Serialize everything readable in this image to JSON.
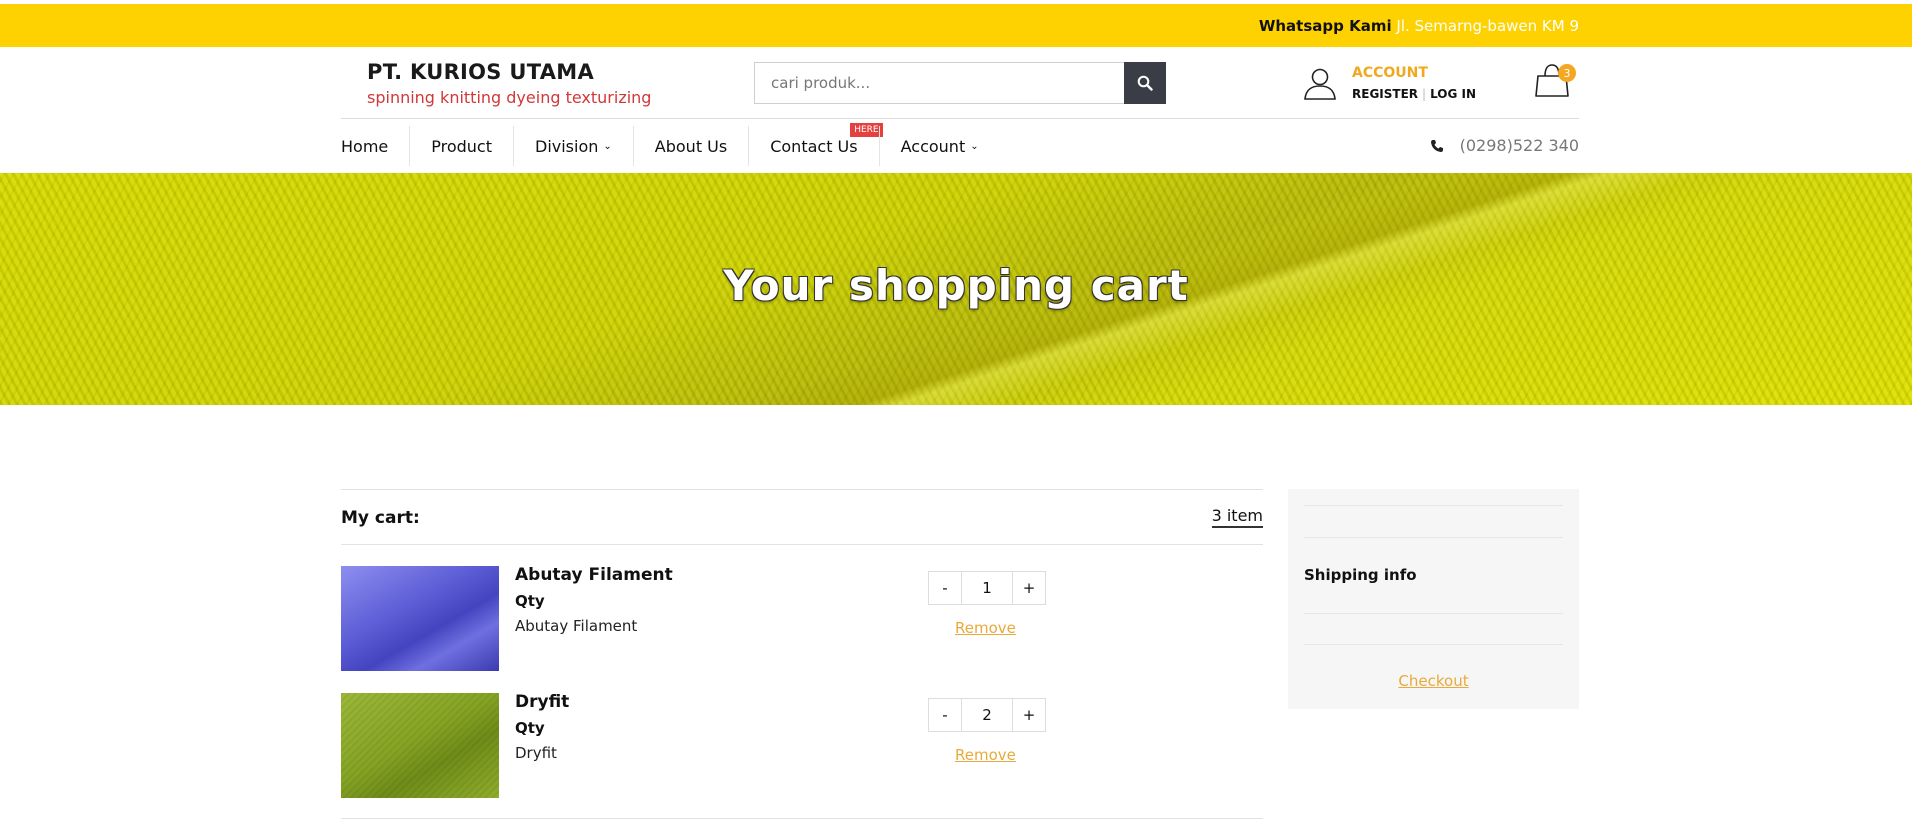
{
  "topbar": {
    "whatsapp_label": "Whatsapp Kami",
    "address": "Jl. Semarng-bawen KM 9"
  },
  "brand": {
    "name": "PT. KURIOS UTAMA",
    "tagline": "spinning knitting dyeing texturizing"
  },
  "search": {
    "placeholder": "cari produk..."
  },
  "account": {
    "label": "ACCOUNT",
    "register": "REGISTER",
    "login": "LOG IN"
  },
  "cart_icon": {
    "count": "3"
  },
  "nav": {
    "items": [
      "Home",
      "Product",
      "Division",
      "About Us",
      "Contact Us",
      "Account"
    ],
    "hot_label": "HERE",
    "phone": "(0298)522 340"
  },
  "hero": {
    "title": "Your shopping cart"
  },
  "cart": {
    "title": "My cart:",
    "count_label": "3 item",
    "items": [
      {
        "name": "Abutay Filament",
        "qty_label": "Qty",
        "description": "Abutay Filament",
        "qty": "1",
        "remove": "Remove",
        "color": "#5a5ad0"
      },
      {
        "name": "Dryfit",
        "qty_label": "Qty",
        "description": "Dryfit",
        "qty": "2",
        "remove": "Remove",
        "color": "#8aa824"
      }
    ],
    "minus": "-",
    "plus": "+"
  },
  "sidebar": {
    "shipping_label": "Shipping info",
    "checkout_label": "Checkout"
  },
  "colors": {
    "topbar": "#fed200",
    "accent": "#f0a81e",
    "tagline": "#d0383a",
    "link": "#e9a93b"
  }
}
